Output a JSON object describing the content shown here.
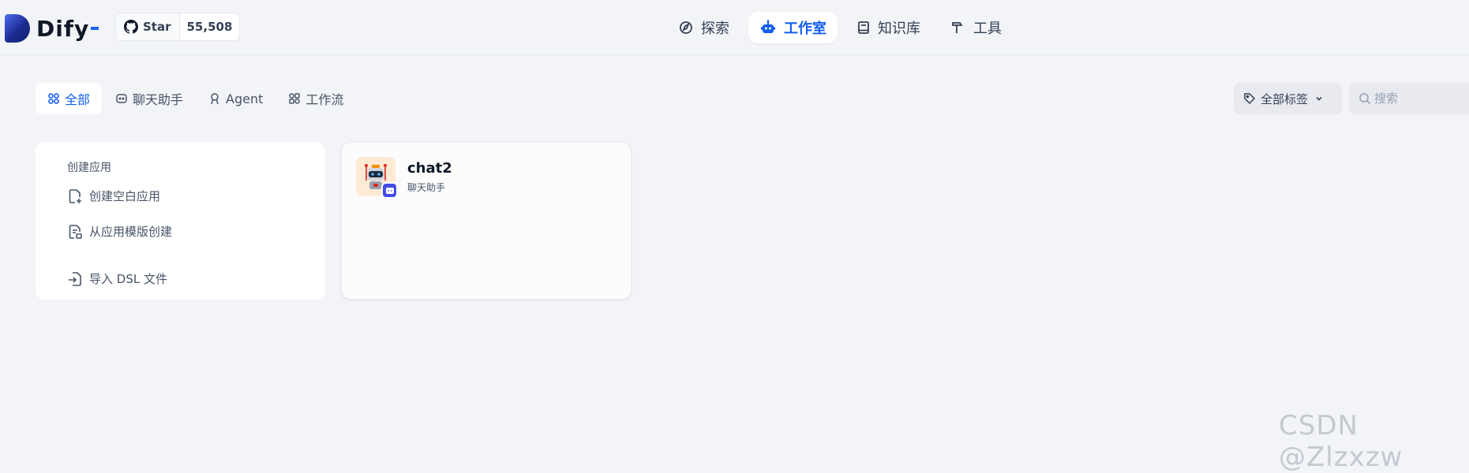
{
  "header": {
    "logo_text": "Dify",
    "github": {
      "label": "Star",
      "count": "55,508"
    },
    "nav": [
      {
        "label": "探索",
        "icon": "compass-icon",
        "active": false
      },
      {
        "label": "工作室",
        "icon": "robot-icon",
        "active": true
      },
      {
        "label": "知识库",
        "icon": "book-icon",
        "active": false
      },
      {
        "label": "工具",
        "icon": "hammer-icon",
        "active": false
      }
    ]
  },
  "filters": {
    "tabs": [
      {
        "label": "全部",
        "icon": "grid-icon",
        "active": true
      },
      {
        "label": "聊天助手",
        "icon": "chat-bubble-icon",
        "active": false
      },
      {
        "label": "Agent",
        "icon": "agent-icon",
        "active": false
      },
      {
        "label": "工作流",
        "icon": "workflow-icon",
        "active": false
      }
    ],
    "tag_filter_label": "全部标签",
    "search_placeholder": "搜索"
  },
  "create_card": {
    "title": "创建应用",
    "options": [
      {
        "label": "创建空白应用",
        "icon": "file-plus-icon"
      },
      {
        "label": "从应用模版创建",
        "icon": "file-template-icon"
      },
      {
        "label": "导入 DSL 文件",
        "icon": "file-import-icon"
      }
    ]
  },
  "apps": [
    {
      "name": "chat2",
      "type": "聊天助手",
      "icon": "robot-avatar-icon",
      "badge_icon": "chat-badge-icon"
    }
  ],
  "watermark": "CSDN @Zlzxzw",
  "colors": {
    "accent": "#155eef",
    "background": "#f2f4f7",
    "badge": "#444ce7",
    "app_icon_bg": "#ffead5"
  }
}
